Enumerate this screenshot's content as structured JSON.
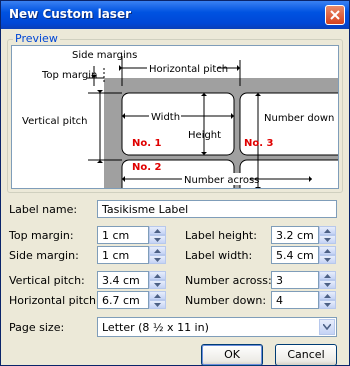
{
  "window": {
    "title": "New Custom laser"
  },
  "preview": {
    "legend": "Preview",
    "labels": {
      "side_margins": "Side margins",
      "top_margin": "Top margin",
      "horizontal_pitch": "Horizontal pitch",
      "vertical_pitch": "Vertical pitch",
      "width": "Width",
      "height": "Height",
      "number_down": "Number down",
      "number_across": "Number across",
      "no1": "No. 1",
      "no2": "No. 2",
      "no3": "No. 3"
    }
  },
  "form": {
    "label_name": {
      "label": "Label name:",
      "value": "Tasikisme Label"
    },
    "top_margin": {
      "label": "Top margin:",
      "value": "1 cm"
    },
    "side_margin": {
      "label": "Side margin:",
      "value": "1 cm"
    },
    "vertical_pitch": {
      "label": "Vertical pitch:",
      "value": "3.4 cm"
    },
    "horizontal_pitch": {
      "label": "Horizontal pitch:",
      "value": "6.7 cm"
    },
    "label_height": {
      "label": "Label height:",
      "value": "3.2 cm"
    },
    "label_width": {
      "label": "Label width:",
      "value": "5.4 cm"
    },
    "number_across": {
      "label": "Number across:",
      "value": "3"
    },
    "number_down": {
      "label": "Number down:",
      "value": "4"
    },
    "page_size": {
      "label": "Page size:",
      "value": "Letter (8 ½ x 11 in)"
    }
  },
  "buttons": {
    "ok": "OK",
    "cancel": "Cancel"
  },
  "colors": {
    "title_bar": "#0053e1",
    "accent_red": "#e00000",
    "legend_blue": "#0046d5"
  }
}
